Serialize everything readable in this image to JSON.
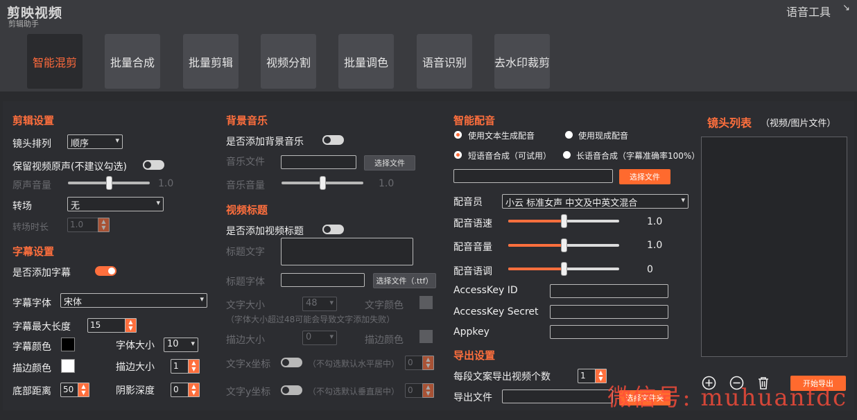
{
  "header": {
    "logo": "剪映视频",
    "logo_sub": "剪辑助手",
    "brand_right": "语音工具",
    "window_icon": "↘"
  },
  "tabs": [
    {
      "label": "智能混剪",
      "active": true
    },
    {
      "label": "批量合成"
    },
    {
      "label": "批量剪辑"
    },
    {
      "label": "视频分割"
    },
    {
      "label": "批量调色"
    },
    {
      "label": "语音识别"
    },
    {
      "label": "去水印裁剪"
    }
  ],
  "edit": {
    "title": "剪辑设置",
    "order_label": "镜头排列",
    "order_value": "顺序",
    "keep_audio_label": "保留视频原声(不建议勾选)",
    "orig_vol_label": "原声音量",
    "orig_vol_value": "1.0",
    "orig_vol_level": 0.5,
    "transition_label": "转场",
    "transition_value": "无",
    "trans_dur_label": "转场时长",
    "trans_dur_value": "1.0"
  },
  "subtitle": {
    "title": "字幕设置",
    "add_label": "是否添加字幕",
    "font_label": "字幕字体",
    "font_value": "宋体",
    "maxlen_label": "字幕最大长度",
    "maxlen_value": "15",
    "color_label": "字幕颜色",
    "color": "#000000",
    "size_label": "字体大小",
    "size_value": "10",
    "stroke_color_label": "描边颜色",
    "stroke_color": "#ffffff",
    "stroke_size_label": "描边大小",
    "stroke_size_value": "1",
    "bottom_label": "底部距离",
    "bottom_value": "50",
    "shadow_label": "阴影深度",
    "shadow_value": "0"
  },
  "bgm": {
    "title": "背景音乐",
    "add_label": "是否添加背景音乐",
    "file_label": "音乐文件",
    "choose": "选择文件",
    "vol_label": "音乐音量",
    "vol_value": "1.0",
    "vol_level": 0.5
  },
  "vtitle": {
    "title": "视频标题",
    "add_label": "是否添加视频标题",
    "text_label": "标题文字",
    "font_label": "标题字体",
    "choose_font": "选择文件（.ttf）",
    "size_label": "文字大小",
    "size_value": "48",
    "color_label": "文字颜色",
    "size_hint": "（字体大小超过48可能会导致文字添加失败）",
    "stroke_size_label": "描边大小",
    "stroke_size_value": "0",
    "stroke_color_label": "描边颜色",
    "x_label": "文字x坐标",
    "x_hint": "（不勾选默认水平居中）",
    "x_value": "0",
    "y_label": "文字y坐标",
    "y_hint": "（不勾选默认垂直居中）",
    "y_value": "0"
  },
  "dub": {
    "title": "智能配音",
    "r1": "使用文本生成配音",
    "r2": "使用现成配音",
    "r3": "短语音合成（可试用）",
    "r4": "长语音合成（字幕准确率100%）",
    "choose": "选择文件",
    "voice_label": "配音员",
    "voice_value": "小云  标准女声  中文及中英文混合",
    "speed_label": "配音语速",
    "speed_value": "1.0",
    "speed_level": 0.5,
    "vol_label": "配音音量",
    "vol_value": "1.0",
    "vol_level": 0.5,
    "pitch_label": "配音语调",
    "pitch_value": "0",
    "pitch_level": 0.5,
    "ak_label": "AccessKey ID",
    "secret_label": "AccessKey Secret",
    "appkey_label": "Appkey"
  },
  "export": {
    "title": "导出设置",
    "count_label": "每段文案导出视频个数",
    "count_value": "1",
    "file_label": "导出文件",
    "choose": "选择文件夹",
    "start": "开始导出"
  },
  "shots": {
    "title": "镜头列表",
    "sub": "（视频/图片文件）"
  },
  "watermark": "微信号: muhuanfdc",
  "colors": {
    "accent": "#ff6f3d",
    "bg": "#2c2d31"
  }
}
